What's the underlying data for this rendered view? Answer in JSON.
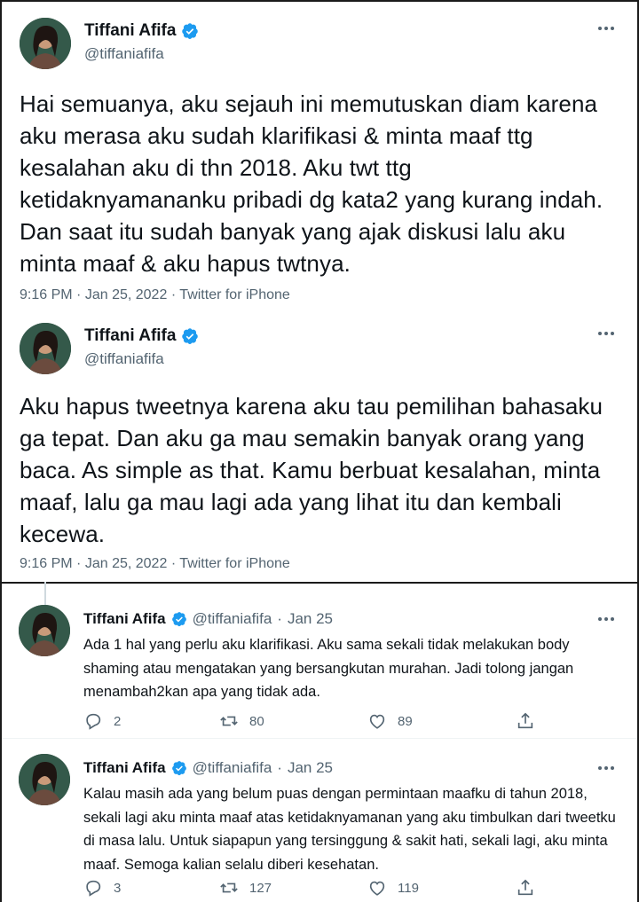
{
  "tweets": [
    {
      "author": {
        "name": "Tiffani Afifa",
        "handle": "@tiffaniafifa"
      },
      "text": "Hai semuanya, aku sejauh ini memutuskan diam karena aku merasa aku sudah klarifikasi & minta maaf ttg kesalahan aku di thn 2018. Aku twt ttg ketidaknyamananku pribadi dg kata2 yang kurang indah. Dan saat itu sudah banyak yang ajak diskusi lalu aku minta maaf & aku hapus twtnya.",
      "time": "9:16 PM",
      "date": "Jan 25, 2022",
      "source": "Twitter for iPhone"
    },
    {
      "author": {
        "name": "Tiffani Afifa",
        "handle": "@tiffaniafifa"
      },
      "text": "Aku hapus tweetnya karena aku tau pemilihan bahasaku ga tepat. Dan aku ga mau semakin banyak orang yang baca. As simple as that. Kamu berbuat kesalahan, minta maaf, lalu ga mau lagi ada yang lihat itu dan kembali kecewa.",
      "time": "9:16 PM",
      "date": "Jan 25, 2022",
      "source": "Twitter for iPhone"
    }
  ],
  "replies": [
    {
      "author": {
        "name": "Tiffani Afifa",
        "handle": "@tiffaniafifa"
      },
      "date": "Jan 25",
      "text": "Ada 1 hal yang perlu aku klarifikasi. Aku sama sekali tidak melakukan body shaming atau mengatakan yang bersangkutan murahan. Jadi tolong jangan menambah2kan apa yang tidak ada.",
      "replies": "2",
      "retweets": "80",
      "likes": "89"
    },
    {
      "author": {
        "name": "Tiffani Afifa",
        "handle": "@tiffaniafifa"
      },
      "date": "Jan 25",
      "text": "Kalau masih ada yang belum puas dengan permintaan maafku di tahun 2018, sekali lagi aku minta maaf atas ketidaknyamanan yang aku timbulkan dari tweetku di masa lalu. Untuk siapapun yang tersinggung & sakit hati, sekali lagi, aku minta maaf. Semoga kalian selalu diberi kesehatan.",
      "replies": "3",
      "retweets": "127",
      "likes": "119"
    }
  ],
  "separator": "·",
  "colors": {
    "verified": "#1d9bf0",
    "text": "#0f1419",
    "secondary": "#536471"
  },
  "icons": [
    "more-icon",
    "verified-icon",
    "reply-icon",
    "retweet-icon",
    "like-icon",
    "share-icon"
  ]
}
